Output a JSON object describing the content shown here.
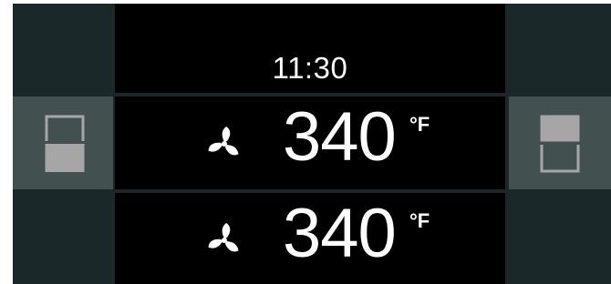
{
  "display": {
    "clock": "11:30"
  },
  "upper_oven": {
    "mode_icon": "convection-fan-icon",
    "temperature": "340",
    "unit": "°F",
    "selector_icon": "upper-oven-icon"
  },
  "lower_oven": {
    "mode_icon": "convection-fan-icon",
    "temperature": "340",
    "unit": "°F",
    "selector_icon": "lower-oven-icon"
  },
  "colors": {
    "background": "#1b2829",
    "active_side": "#435050",
    "panel": "#000000",
    "text": "#ffffff",
    "icon_fill": "#a6a6a6"
  }
}
